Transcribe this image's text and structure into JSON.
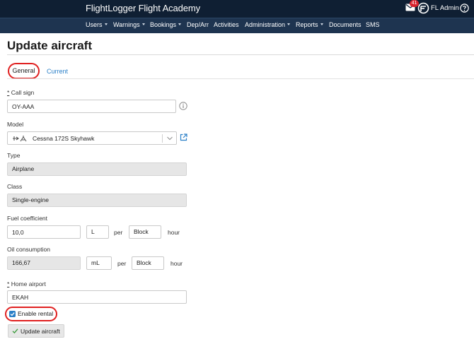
{
  "header": {
    "brand": "FlightLogger Flight Academy",
    "mail_count": "41",
    "user_name": "FL Admin"
  },
  "nav": {
    "items": [
      {
        "label": "Users",
        "dropdown": true
      },
      {
        "label": "Warnings",
        "dropdown": true
      },
      {
        "label": "Bookings",
        "dropdown": true
      },
      {
        "label": "Dep/Arr",
        "dropdown": false
      },
      {
        "label": "Activities",
        "dropdown": false
      },
      {
        "label": "Administration",
        "dropdown": true
      },
      {
        "label": "Reports",
        "dropdown": true
      },
      {
        "label": "Documents",
        "dropdown": false
      },
      {
        "label": "SMS",
        "dropdown": false
      }
    ]
  },
  "page": {
    "title": "Update aircraft",
    "tabs": [
      {
        "label": "General",
        "active": true
      },
      {
        "label": "Current",
        "active": false
      }
    ]
  },
  "form": {
    "required_mark": "*",
    "call_sign": {
      "label": "Call sign",
      "value": "OY-AAA"
    },
    "model": {
      "label": "Model",
      "value": "Cessna 172S Skyhawk"
    },
    "type": {
      "label": "Type",
      "value": "Airplane"
    },
    "class": {
      "label": "Class",
      "value": "Single-engine"
    },
    "fuel": {
      "label": "Fuel coefficient",
      "value": "10,0",
      "unit": "L",
      "per": "per",
      "basis": "Block",
      "suffix": "hour"
    },
    "oil": {
      "label": "Oil consumption",
      "value": "166,67",
      "unit": "mL",
      "per": "per",
      "basis": "Block",
      "suffix": "hour"
    },
    "home_airport": {
      "label": "Home airport",
      "value": "EKAH"
    },
    "enable_rental": {
      "label": "Enable rental",
      "checked": true
    },
    "submit_label": "Update aircraft"
  },
  "colors": {
    "topbar": "#0f1f33",
    "navbar": "#1e3450",
    "accent": "#2a7fc7",
    "highlight": "#e02020",
    "badge": "#d9232e"
  },
  "icons": [
    "mail-icon",
    "flightlogger-logo-icon",
    "help-icon",
    "info-icon",
    "airplane-icon",
    "chevron-down-icon",
    "external-link-icon",
    "checkbox-checked-icon",
    "check-icon"
  ]
}
